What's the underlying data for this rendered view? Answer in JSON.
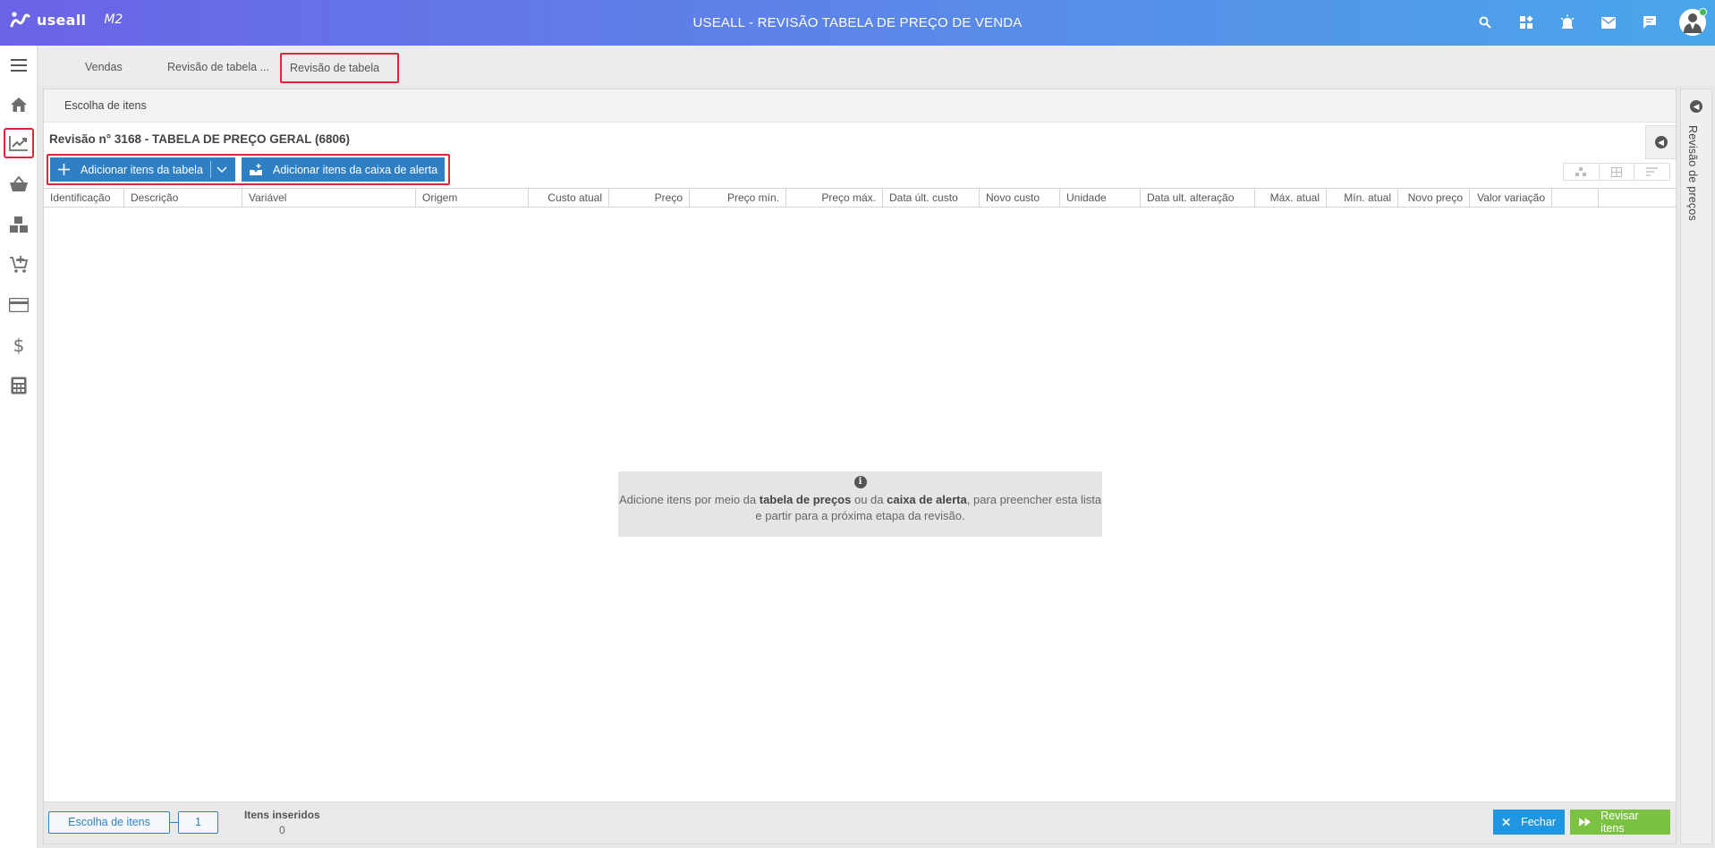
{
  "header": {
    "logo_text": "useall",
    "logo_version": "M2",
    "title": "USEALL - REVISÃO TABELA DE PREÇO DE VENDA",
    "icons": [
      "search-icon",
      "apps-icon",
      "alarm-icon",
      "mail-icon",
      "chat-icon",
      "user-avatar"
    ]
  },
  "leftnav": {
    "items": [
      "menu-icon",
      "home-icon",
      "trending-chart-icon",
      "basket-icon",
      "boxes-icon",
      "add-cart-icon",
      "credit-card-icon",
      "dollar-icon",
      "calculator-icon"
    ],
    "active": "trending-chart-icon"
  },
  "tabs": [
    {
      "label": "Vendas"
    },
    {
      "label": "Revisão de tabela ..."
    },
    {
      "label": "Revisão de tabela ...",
      "active": true
    }
  ],
  "panel": {
    "header": "Escolha de itens",
    "revision_title": "Revisão n° 3168 - TABELA DE PREÇO GERAL (6806)",
    "add_table_button": "Adicionar itens da tabela",
    "add_alert_button": "Adicionar itens da caixa de alerta",
    "columns": [
      "Identificação",
      "Descrição",
      "Variável",
      "Origem",
      "Custo atual",
      "Preço",
      "Preço mín.",
      "Preço máx.",
      "Data últ. custo",
      "Novo custo",
      "Unidade",
      "Data ult. alteração",
      "Máx. atual",
      "Mín. atual",
      "Novo preço",
      "Valor variação"
    ],
    "empty_message": {
      "part1": "Adicione itens por meio da ",
      "bold1": "tabela de preços",
      "part2": " ou da ",
      "bold2": "caixa de alerta",
      "part3": ", para preencher esta lista e partir para a próxima etapa da revisão."
    }
  },
  "footer": {
    "step_label": "Escolha de itens",
    "step_number": "1",
    "inserted_label": "Itens inseridos",
    "inserted_count": "0",
    "close_button": "Fechar",
    "review_button": "Revisar itens"
  },
  "side_panel": {
    "label": "Revisão de preços"
  },
  "colors": {
    "header_gradient_start": "#6b63e6",
    "header_gradient_end": "#4aa6ea",
    "primary_button": "#2f7fc4",
    "close_button": "#2196e0",
    "review_button": "#7cc242",
    "highlight": "#e0263b"
  }
}
